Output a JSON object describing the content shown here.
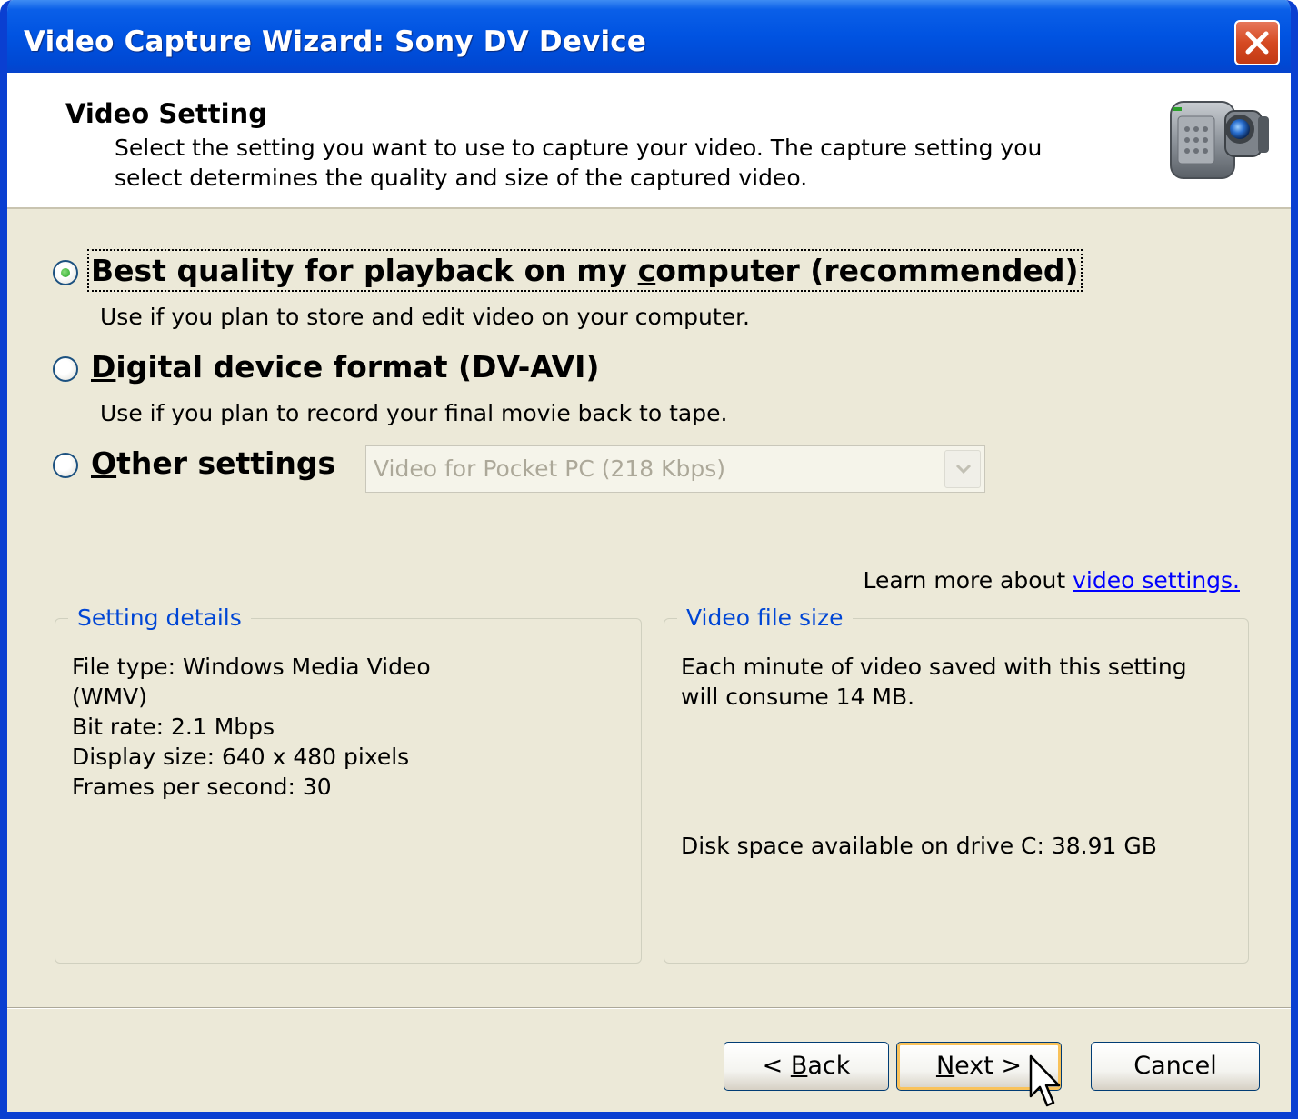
{
  "window": {
    "title": "Video Capture Wizard: Sony DV Device"
  },
  "header": {
    "title": "Video Setting",
    "description": "Select the setting you want to use to capture your video. The capture setting you select determines the quality and size of the captured video."
  },
  "options": [
    {
      "label_pre": "Best quality for playback on my ",
      "label_hot": "c",
      "label_post": "omputer (recommended)",
      "description": "Use if you plan to store and edit video on your computer.",
      "selected": true
    },
    {
      "label_pre": "",
      "label_hot": "D",
      "label_post": "igital device format (DV-AVI)",
      "description": "Use if you plan to record your final movie back to tape.",
      "selected": false
    },
    {
      "label_pre": "",
      "label_hot": "O",
      "label_post": "ther settings",
      "selected": false
    }
  ],
  "other_select": {
    "value": "Video for Pocket PC (218 Kbps)",
    "enabled": false
  },
  "learn_more": {
    "text": "Learn more about ",
    "link": "video settings."
  },
  "setting_details": {
    "legend": "Setting details",
    "lines": [
      "File type: Windows Media Video",
      "(WMV)",
      "Bit rate: 2.1 Mbps",
      "Display size: 640 x 480 pixels",
      "Frames per second: 30"
    ]
  },
  "video_file_size": {
    "legend": "Video file size",
    "lines": [
      "Each minute of video saved with this setting",
      "will consume 14 MB."
    ],
    "disk_space": "Disk space available on drive C: 38.91 GB"
  },
  "buttons": {
    "back_pre": "< ",
    "back_hot": "B",
    "back_post": "ack",
    "next_hot": "N",
    "next_post": "ext >",
    "cancel": "Cancel"
  },
  "colors": {
    "title_bar": "#0053e1",
    "dialog_bg": "#ece9d8",
    "group_legend": "#0046d5",
    "link": "#0000ff",
    "close_button": "#d64a22",
    "radio_dot": "#21a121"
  },
  "icons": {
    "camera": "camcorder-icon",
    "close": "close-icon",
    "dropdown": "chevron-down-icon",
    "cursor": "mouse-pointer-icon"
  }
}
